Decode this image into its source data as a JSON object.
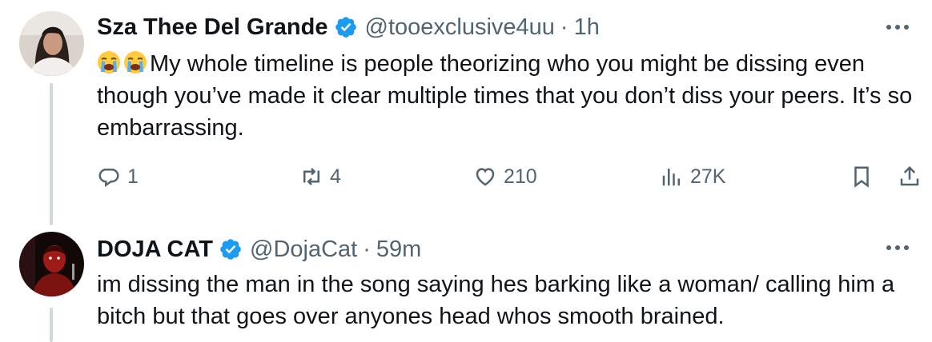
{
  "tweets": [
    {
      "author": "Sza Thee Del Grande",
      "handle": "@tooexclusive4uu",
      "separator": "·",
      "time": "1h",
      "text": "My whole timeline is people theorizing who you might be dissing even though you’ve made it clear multiple times that you don’t diss your peers. It’s so embarrassing.",
      "emoji": [
        "loudly-crying-face",
        "loudly-crying-face"
      ],
      "stats": {
        "replies": "1",
        "reposts": "4",
        "likes": "210",
        "views": "27K"
      },
      "icons": [
        "verified-icon",
        "more-icon",
        "reply-icon",
        "repost-icon",
        "like-icon",
        "views-icon",
        "bookmark-icon",
        "share-icon"
      ]
    },
    {
      "author": "DOJA CAT",
      "handle": "@DojaCat",
      "separator": "·",
      "time": "59m",
      "text": "im dissing the man in the song saying hes barking like a woman/ calling him a bitch but that goes over anyones head whos smooth brained.",
      "icons": [
        "verified-icon",
        "more-icon"
      ]
    }
  ],
  "colors": {
    "text": "#0f1419",
    "secondary": "#536471",
    "verified": "#1d9bf0",
    "thread_line": "#cfd9de"
  }
}
